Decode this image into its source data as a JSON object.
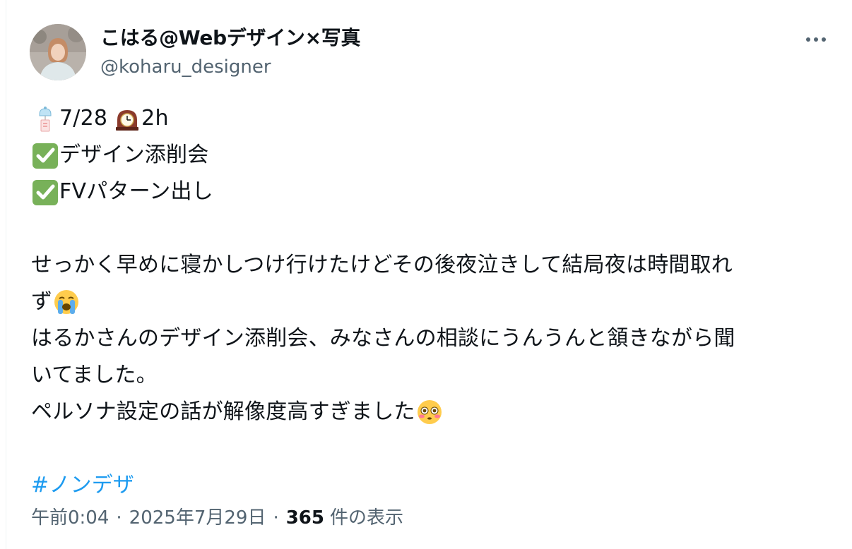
{
  "author": {
    "display_name": "こはる@Webデザイン×写真",
    "handle": "@koharu_designer"
  },
  "icons": {
    "more": "more-dots-icon",
    "wind_chime": "wind-chime-icon",
    "clock": "mantelpiece-clock-icon",
    "check": "white-check-mark-icon",
    "crying": "loudly-crying-face-icon",
    "flushed": "flushed-face-icon"
  },
  "tweet": {
    "line1_date": "7/28",
    "line1_hours": "2h",
    "check1": "デザイン添削会",
    "check2": "FVパターン出し",
    "para1_line1": "せっかく早めに寝かしつけ行けたけどその後夜泣きして結局夜は時間取れ",
    "para1_line2": "ず",
    "para2_line1": "はるかさんのデザイン添削会、みなさんの相談にうんうんと頷きながら聞",
    "para2_line2": "いてました。",
    "para3": "ペルソナ設定の話が解像度高すぎました",
    "hashtag": "#ノンデザ"
  },
  "meta": {
    "time": "午前0:04",
    "separator": "·",
    "date": "2025年7月29日",
    "views": "365",
    "views_label": "件の表示"
  },
  "colors": {
    "text": "#0f1419",
    "secondary": "#536471",
    "link": "#1d9bf0",
    "check_green": "#78b159"
  }
}
